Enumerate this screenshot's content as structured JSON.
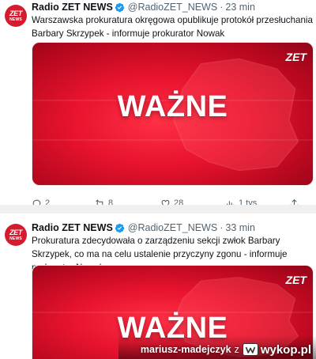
{
  "tweets": [
    {
      "author": "Radio ZET NEWS",
      "handle": "@RadioZET_NEWS",
      "separator": "·",
      "time": "23 min",
      "text": "Warszawska prokuratura okręgowa opublikuje protokół przesłuchania Barbary Skrzypek - informuje prokurator Nowak",
      "media_headline": "WAŻNE",
      "media_logo": "ZET",
      "avatar": {
        "line1": "ZET",
        "line2": "NEWS"
      },
      "stats": {
        "replies": "2",
        "retweets": "8",
        "likes": "28",
        "views": "1 tys."
      }
    },
    {
      "author": "Radio ZET NEWS",
      "handle": "@RadioZET_NEWS",
      "separator": "·",
      "time": "33 min",
      "text": "Prokuratura zdecydowała o zarządzeniu sekcji zwłok Barbary Skrzypek, co ma na celu ustalenie przyczyny zgonu - informuje prokurator Nowak",
      "media_headline": "WAŻNE",
      "media_logo": "ZET",
      "avatar": {
        "line1": "ZET",
        "line2": "NEWS"
      }
    }
  ],
  "watermark": {
    "user": "mariusz-madejczyk",
    "joiner": "z",
    "site": "wykop.pl"
  },
  "colors": {
    "brand_red": "#e8132e",
    "verified_blue": "#1d9bf0",
    "muted": "#536471"
  }
}
